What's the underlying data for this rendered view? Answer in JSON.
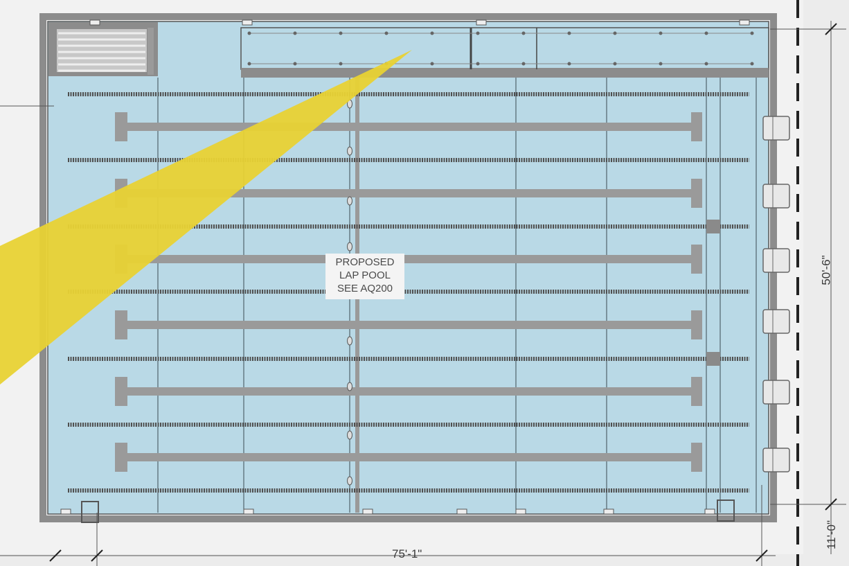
{
  "drawing": {
    "pool_label": [
      "PROPOSED",
      "LAP POOL",
      "SEE AQ200"
    ],
    "dimensions": {
      "overall_width": "75'-1\"",
      "overall_length": "50'-6\"",
      "offset": "11'-0\""
    },
    "colors": {
      "water": "#b9d9e6",
      "deck": "#f2f2f2",
      "wall": "#8c8c8c",
      "lane_rope": "#4e4e4e",
      "lane_marking": "#9a9a9a",
      "callout": "#e8d234"
    },
    "lanes": 6,
    "lane_ropes": 7
  }
}
